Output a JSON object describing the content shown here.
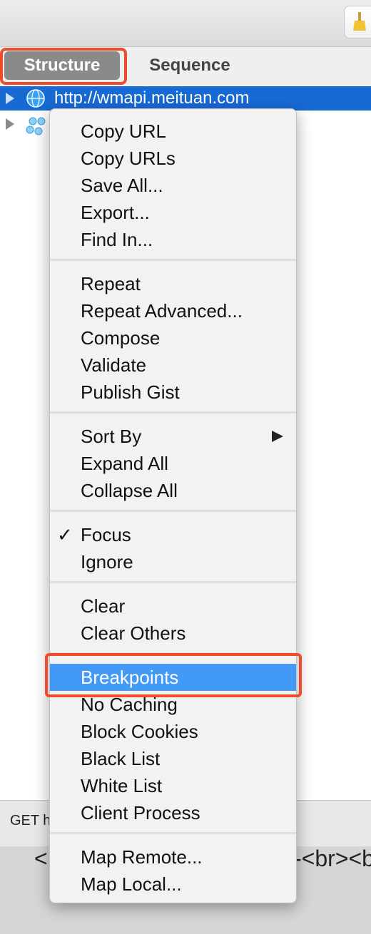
{
  "tabs": {
    "structure": "Structure",
    "sequence": "Sequence"
  },
  "tree": {
    "selected_host": "http://wmapi.meituan.com"
  },
  "bottom": {
    "request_fragment": "GET h",
    "body_left": "<",
    "body_right": "-<br><b"
  },
  "menu": {
    "group1": [
      "Copy URL",
      "Copy URLs",
      "Save All...",
      "Export...",
      "Find In..."
    ],
    "group2": [
      "Repeat",
      "Repeat Advanced...",
      "Compose",
      "Validate",
      "Publish Gist"
    ],
    "group3": [
      "Sort By",
      "Expand All",
      "Collapse All"
    ],
    "group4": [
      "Focus",
      "Ignore"
    ],
    "group5": [
      "Clear",
      "Clear Others"
    ],
    "group6": [
      "Breakpoints",
      "No Caching",
      "Block Cookies",
      "Black List",
      "White List",
      "Client Process"
    ],
    "group7": [
      "Map Remote...",
      "Map Local..."
    ],
    "check_mark": "✓"
  },
  "colors": {
    "selection": "#1769d4",
    "menu_highlight": "#4299f6",
    "annotation": "#ee4c2c"
  }
}
